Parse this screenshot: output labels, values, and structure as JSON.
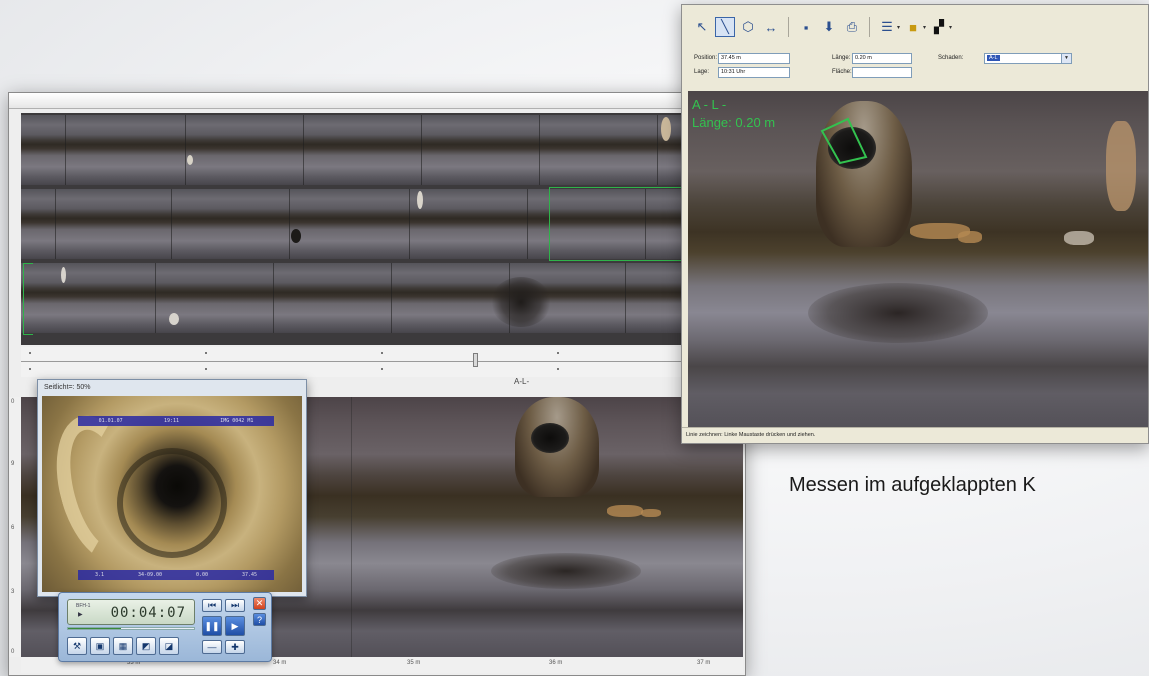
{
  "caption": "Messen im aufgeklappten K",
  "main_window": {
    "section_label": "A-L-",
    "axis_bottom_ticks": [
      "33 m",
      "34 m",
      "35 m",
      "36 m",
      "37 m"
    ],
    "axis_left_ticks": [
      "0",
      "9",
      "6",
      "3",
      "0"
    ]
  },
  "inset_camera": {
    "title": "Seitlicht=: 50%",
    "osd_top": [
      "01.01.07",
      "19:11",
      "IMG 0042 M1"
    ],
    "osd_bottom": [
      "3.1",
      "34-09.00",
      "0.00",
      "37.45"
    ]
  },
  "player": {
    "lcd_mode": "BFH-1",
    "lcd_play": "▶",
    "time": "00:04:07",
    "progress_fraction": 0.42,
    "buttons": {
      "step_back": "⏮",
      "step_forward": "⏭",
      "pause": "❚❚",
      "play": "▶",
      "close": "✕",
      "help": "?",
      "minus": "—",
      "plus": "✚"
    }
  },
  "measure_window": {
    "fields": {
      "position_label": "Position:",
      "position_value": "37.45 m",
      "lage_label": "Lage:",
      "lage_value": "10:31 Uhr",
      "laenge_label": "Länge:",
      "laenge_value": "0.20 m",
      "flaeche_label": "Fläche:",
      "flaeche_value": "",
      "schaden_label": "Schaden:",
      "schaden_value": "A-L"
    },
    "overlay_code": "A - L -",
    "overlay_length": "Länge: 0.20 m",
    "status_text": "Linie zeichnen: Linke Maustaste drücken und ziehen."
  },
  "colors": {
    "measure_green": "#33c24f",
    "selection_blue": "#2f56b6"
  }
}
